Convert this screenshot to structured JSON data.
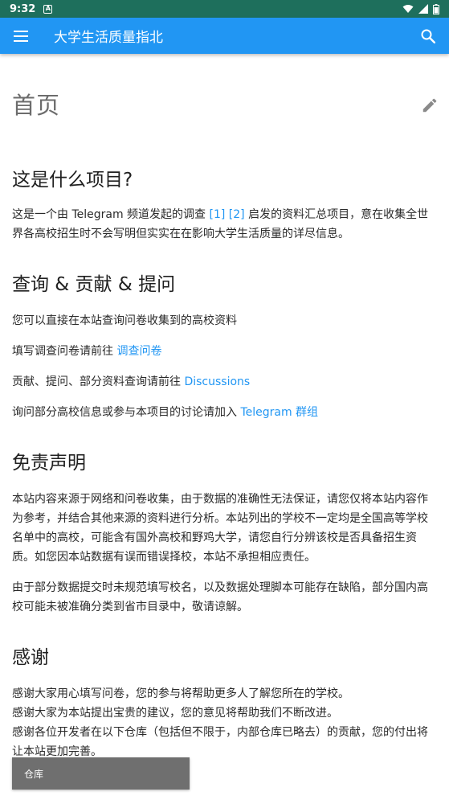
{
  "status_bar": {
    "time": "9:32",
    "notification_glyph": "A"
  },
  "app_bar": {
    "title": "大学生活质量指北",
    "menu_icon": "hamburger-menu-icon",
    "search_icon": "search-icon"
  },
  "page": {
    "title": "首页",
    "edit_icon": "pencil-edit-icon"
  },
  "section1": {
    "heading": "这是什么项目?",
    "text_before": "这是一个由 Telegram 频道发起的调查 ",
    "ref1": "[1]",
    "ref2": "[2]",
    "text_after": " 启发的资料汇总项目，意在收集全世界各高校招生时不会写明但实实在在影响大学生活质量的详尽信息。"
  },
  "section2": {
    "heading": "查询 & 贡献 & 提问",
    "line1": "您可以直接在本站查询问卷收集到的高校资料",
    "line2_text": "填写调查问卷请前往 ",
    "line2_link": "调查问卷",
    "line3_text": "贡献、提问、部分资料查询请前往 ",
    "line3_link": "Discussions",
    "line4_text": "询问部分高校信息或参与本项目的讨论请加入 ",
    "line4_link": "Telegram 群组"
  },
  "section3": {
    "heading": "免责声明",
    "para1": "本站内容来源于网络和问卷收集，由于数据的准确性无法保证，请您仅将本站内容作为参考，并结合其他来源的资料进行分析。本站列出的学校不一定均是全国高等学校名单中的高校，可能含有国外高校和野鸡大学，请您自行分辨该校是否具备招生资质。如您因本站数据有误而错误择校，本站不承担相应责任。",
    "para2": "由于部分数据提交时未规范填写校名，以及数据处理脚本可能存在缺陷，部分国内高校可能未被准确分类到省市目录中，敬请谅解。"
  },
  "section4": {
    "heading": "感谢",
    "line1": "感谢大家用心填写问卷，您的参与将帮助更多人了解您所在的学校。",
    "line2": "感谢大家为本站提出宝贵的建议，您的意见将帮助我们不断改进。",
    "line3": "感谢各位开发者在以下仓库（包括但不限于，内部仓库已略去）的贡献，您的付出将让本站更加完善。"
  },
  "repo_button": {
    "label": "仓库"
  },
  "colors": {
    "status_bar": "#1e6f5c",
    "app_bar": "#2196f3",
    "link": "#2196f3",
    "button": "#6f6f6f"
  }
}
